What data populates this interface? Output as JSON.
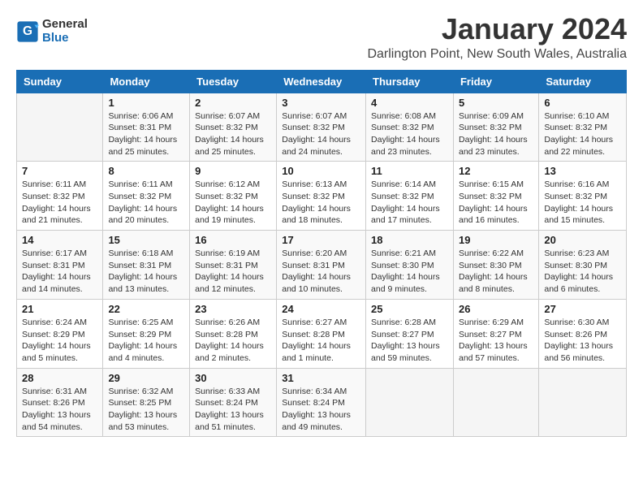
{
  "header": {
    "logo_general": "General",
    "logo_blue": "Blue",
    "title": "January 2024",
    "subtitle": "Darlington Point, New South Wales, Australia"
  },
  "calendar": {
    "days_of_week": [
      "Sunday",
      "Monday",
      "Tuesday",
      "Wednesday",
      "Thursday",
      "Friday",
      "Saturday"
    ],
    "weeks": [
      [
        {
          "day": "",
          "info": ""
        },
        {
          "day": "1",
          "info": "Sunrise: 6:06 AM\nSunset: 8:31 PM\nDaylight: 14 hours\nand 25 minutes."
        },
        {
          "day": "2",
          "info": "Sunrise: 6:07 AM\nSunset: 8:32 PM\nDaylight: 14 hours\nand 25 minutes."
        },
        {
          "day": "3",
          "info": "Sunrise: 6:07 AM\nSunset: 8:32 PM\nDaylight: 14 hours\nand 24 minutes."
        },
        {
          "day": "4",
          "info": "Sunrise: 6:08 AM\nSunset: 8:32 PM\nDaylight: 14 hours\nand 23 minutes."
        },
        {
          "day": "5",
          "info": "Sunrise: 6:09 AM\nSunset: 8:32 PM\nDaylight: 14 hours\nand 23 minutes."
        },
        {
          "day": "6",
          "info": "Sunrise: 6:10 AM\nSunset: 8:32 PM\nDaylight: 14 hours\nand 22 minutes."
        }
      ],
      [
        {
          "day": "7",
          "info": "Sunrise: 6:11 AM\nSunset: 8:32 PM\nDaylight: 14 hours\nand 21 minutes."
        },
        {
          "day": "8",
          "info": "Sunrise: 6:11 AM\nSunset: 8:32 PM\nDaylight: 14 hours\nand 20 minutes."
        },
        {
          "day": "9",
          "info": "Sunrise: 6:12 AM\nSunset: 8:32 PM\nDaylight: 14 hours\nand 19 minutes."
        },
        {
          "day": "10",
          "info": "Sunrise: 6:13 AM\nSunset: 8:32 PM\nDaylight: 14 hours\nand 18 minutes."
        },
        {
          "day": "11",
          "info": "Sunrise: 6:14 AM\nSunset: 8:32 PM\nDaylight: 14 hours\nand 17 minutes."
        },
        {
          "day": "12",
          "info": "Sunrise: 6:15 AM\nSunset: 8:32 PM\nDaylight: 14 hours\nand 16 minutes."
        },
        {
          "day": "13",
          "info": "Sunrise: 6:16 AM\nSunset: 8:32 PM\nDaylight: 14 hours\nand 15 minutes."
        }
      ],
      [
        {
          "day": "14",
          "info": "Sunrise: 6:17 AM\nSunset: 8:31 PM\nDaylight: 14 hours\nand 14 minutes."
        },
        {
          "day": "15",
          "info": "Sunrise: 6:18 AM\nSunset: 8:31 PM\nDaylight: 14 hours\nand 13 minutes."
        },
        {
          "day": "16",
          "info": "Sunrise: 6:19 AM\nSunset: 8:31 PM\nDaylight: 14 hours\nand 12 minutes."
        },
        {
          "day": "17",
          "info": "Sunrise: 6:20 AM\nSunset: 8:31 PM\nDaylight: 14 hours\nand 10 minutes."
        },
        {
          "day": "18",
          "info": "Sunrise: 6:21 AM\nSunset: 8:30 PM\nDaylight: 14 hours\nand 9 minutes."
        },
        {
          "day": "19",
          "info": "Sunrise: 6:22 AM\nSunset: 8:30 PM\nDaylight: 14 hours\nand 8 minutes."
        },
        {
          "day": "20",
          "info": "Sunrise: 6:23 AM\nSunset: 8:30 PM\nDaylight: 14 hours\nand 6 minutes."
        }
      ],
      [
        {
          "day": "21",
          "info": "Sunrise: 6:24 AM\nSunset: 8:29 PM\nDaylight: 14 hours\nand 5 minutes."
        },
        {
          "day": "22",
          "info": "Sunrise: 6:25 AM\nSunset: 8:29 PM\nDaylight: 14 hours\nand 4 minutes."
        },
        {
          "day": "23",
          "info": "Sunrise: 6:26 AM\nSunset: 8:28 PM\nDaylight: 14 hours\nand 2 minutes."
        },
        {
          "day": "24",
          "info": "Sunrise: 6:27 AM\nSunset: 8:28 PM\nDaylight: 14 hours\nand 1 minute."
        },
        {
          "day": "25",
          "info": "Sunrise: 6:28 AM\nSunset: 8:27 PM\nDaylight: 13 hours\nand 59 minutes."
        },
        {
          "day": "26",
          "info": "Sunrise: 6:29 AM\nSunset: 8:27 PM\nDaylight: 13 hours\nand 57 minutes."
        },
        {
          "day": "27",
          "info": "Sunrise: 6:30 AM\nSunset: 8:26 PM\nDaylight: 13 hours\nand 56 minutes."
        }
      ],
      [
        {
          "day": "28",
          "info": "Sunrise: 6:31 AM\nSunset: 8:26 PM\nDaylight: 13 hours\nand 54 minutes."
        },
        {
          "day": "29",
          "info": "Sunrise: 6:32 AM\nSunset: 8:25 PM\nDaylight: 13 hours\nand 53 minutes."
        },
        {
          "day": "30",
          "info": "Sunrise: 6:33 AM\nSunset: 8:24 PM\nDaylight: 13 hours\nand 51 minutes."
        },
        {
          "day": "31",
          "info": "Sunrise: 6:34 AM\nSunset: 8:24 PM\nDaylight: 13 hours\nand 49 minutes."
        },
        {
          "day": "",
          "info": ""
        },
        {
          "day": "",
          "info": ""
        },
        {
          "day": "",
          "info": ""
        }
      ]
    ]
  }
}
